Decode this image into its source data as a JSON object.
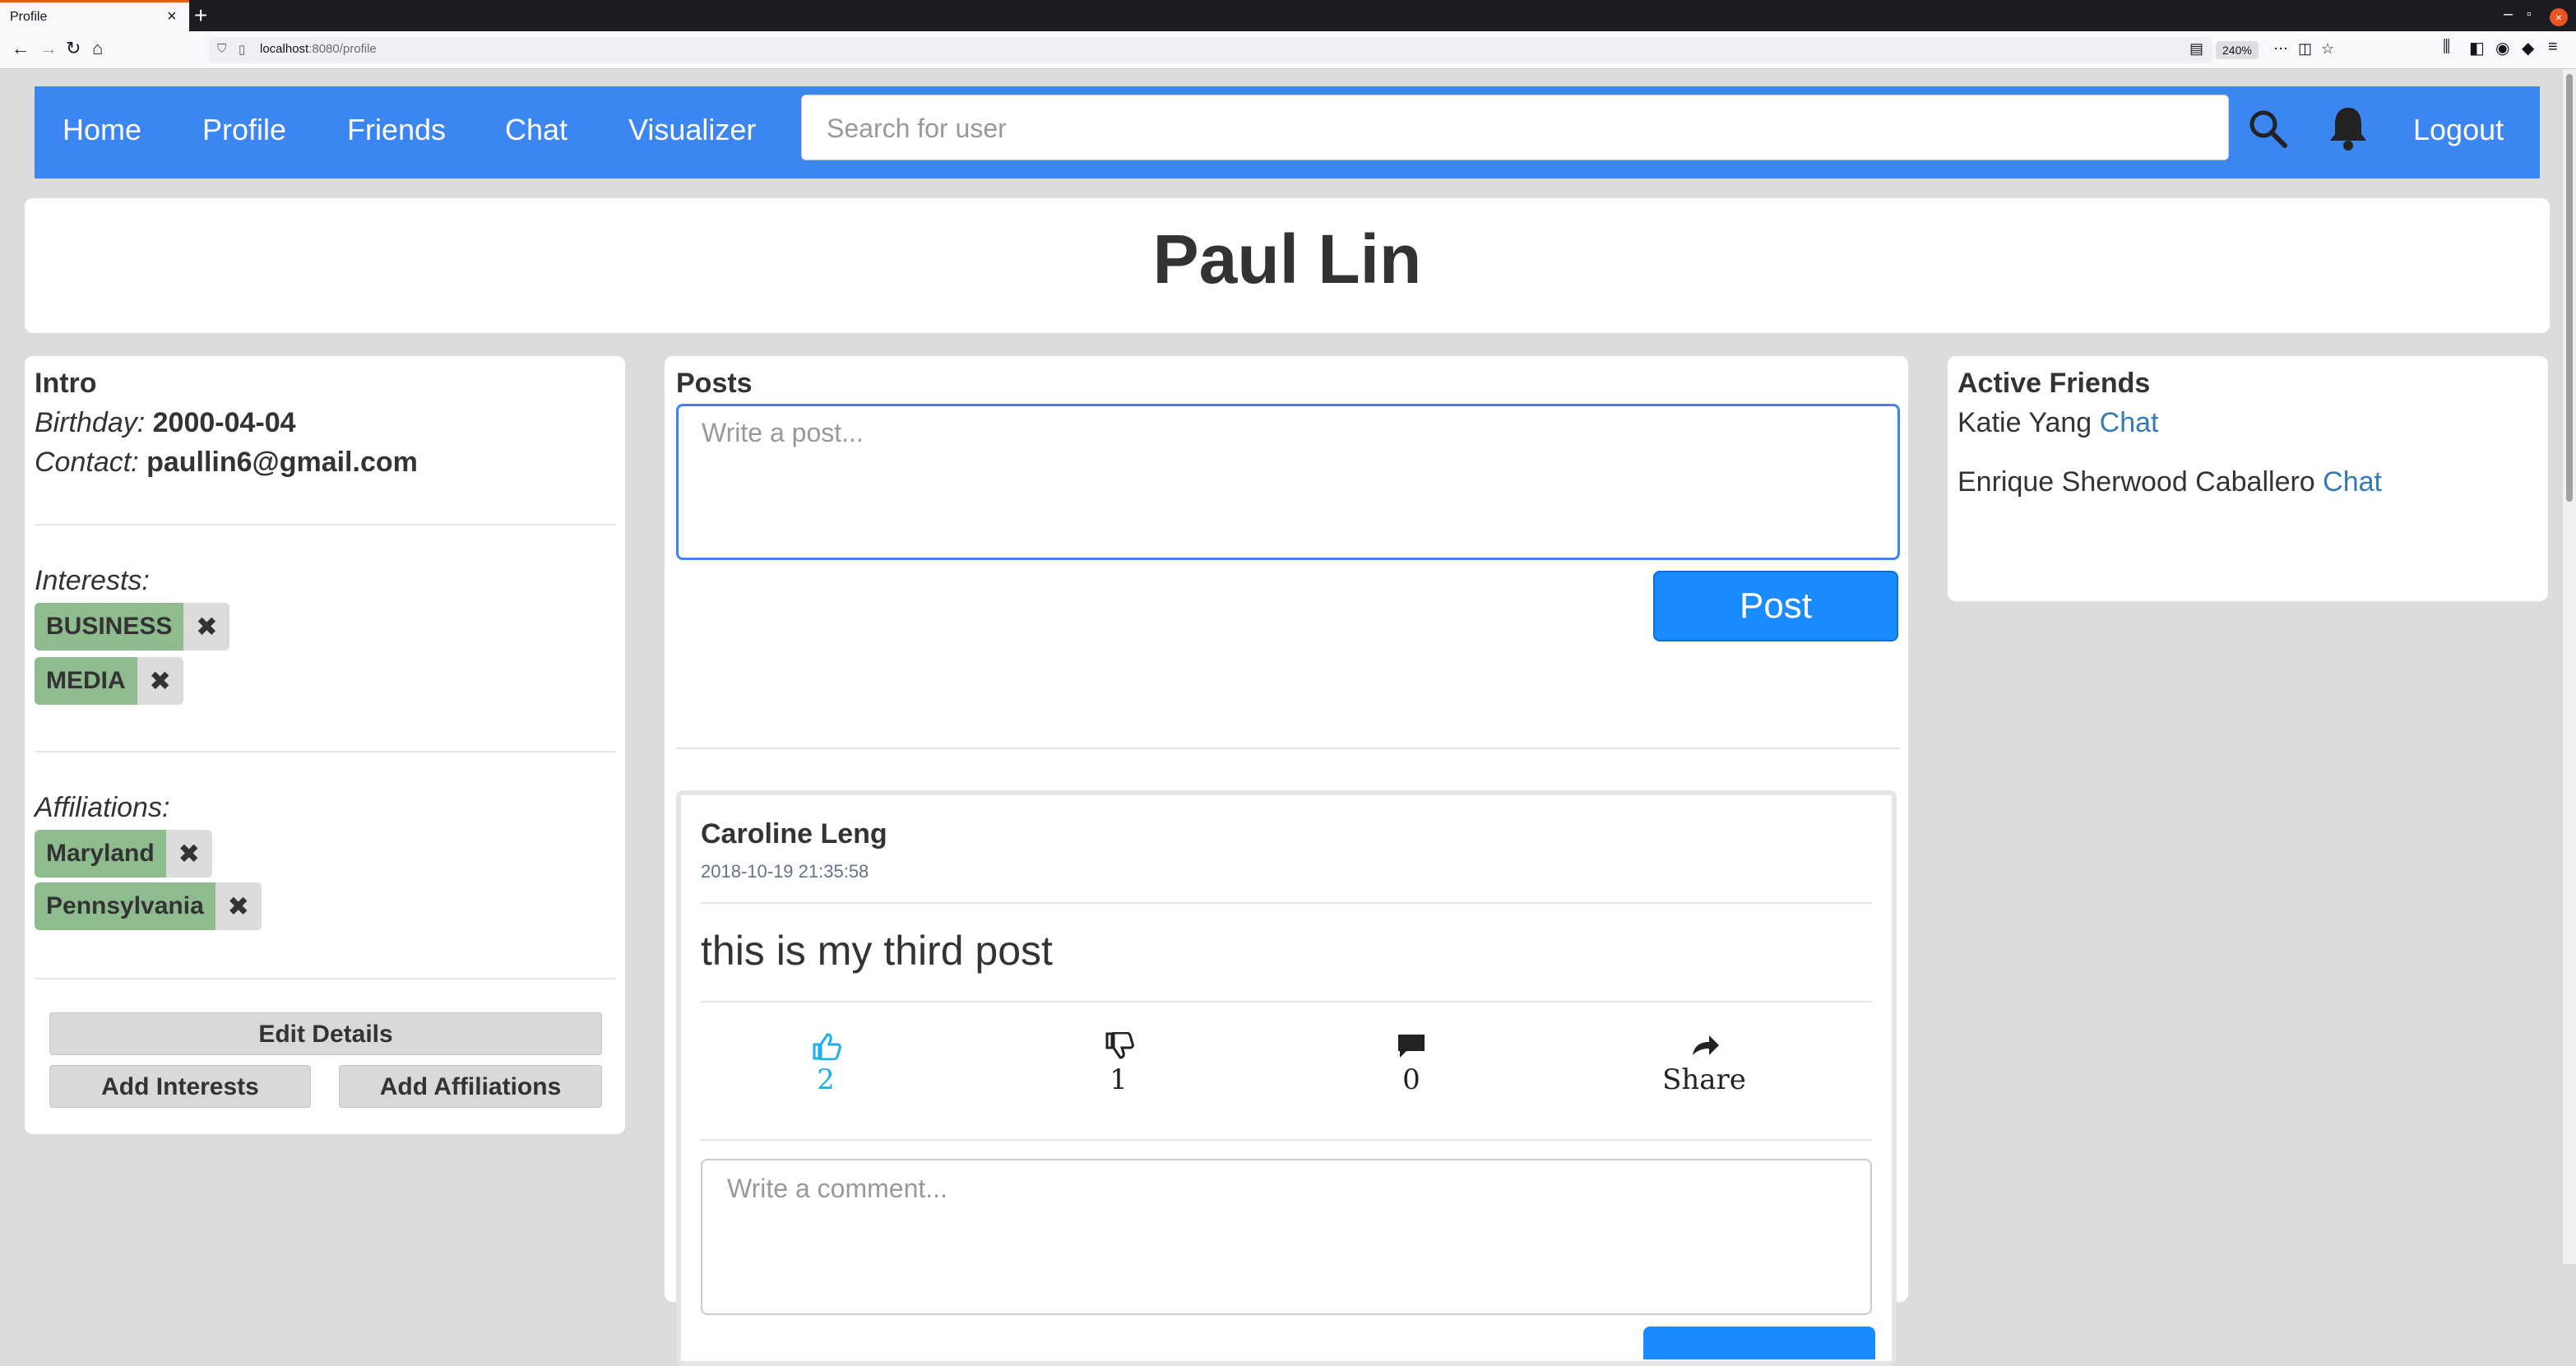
{
  "browser": {
    "tab_title": "Profile",
    "url_host": "localhost",
    "url_rest": ":8080/profile",
    "zoom": "240%"
  },
  "nav": {
    "home": "Home",
    "profile": "Profile",
    "friends": "Friends",
    "chat": "Chat",
    "visualizer": "Visualizer",
    "search_placeholder": "Search for user",
    "logout": "Logout"
  },
  "profile": {
    "name": "Paul Lin"
  },
  "intro": {
    "title": "Intro",
    "birthday_label": "Birthday:",
    "birthday": "2000-04-04",
    "contact_label": "Contact:",
    "contact": "paullin6@gmail.com",
    "interests_label": "Interests:",
    "interests": [
      "BUSINESS",
      "MEDIA"
    ],
    "affiliations_label": "Affiliations:",
    "affiliations": [
      "Maryland",
      "Pennsylvania"
    ],
    "edit_button": "Edit Details",
    "add_interests_button": "Add Interests",
    "add_affiliations_button": "Add Affiliations"
  },
  "posts": {
    "title": "Posts",
    "placeholder": "Write a post...",
    "post_button": "Post",
    "items": [
      {
        "author": "Caroline Leng",
        "timestamp": "2018-10-19 21:35:58",
        "text": "this is my third post",
        "likes": "2",
        "dislikes": "1",
        "comments": "0",
        "share_label": "Share",
        "comment_placeholder": "Write a comment..."
      }
    ]
  },
  "friends": {
    "title": "Active Friends",
    "items": [
      {
        "name": "Katie Yang",
        "action": "Chat"
      },
      {
        "name": "Enrique Sherwood Caballero",
        "action": "Chat"
      }
    ]
  },
  "colors": {
    "nav_bg": "#3b86f1",
    "tag_bg": "#8fbc8f",
    "like_active": "#1ab0e8",
    "link": "#337ab7",
    "post_button": "#1a8cff"
  }
}
